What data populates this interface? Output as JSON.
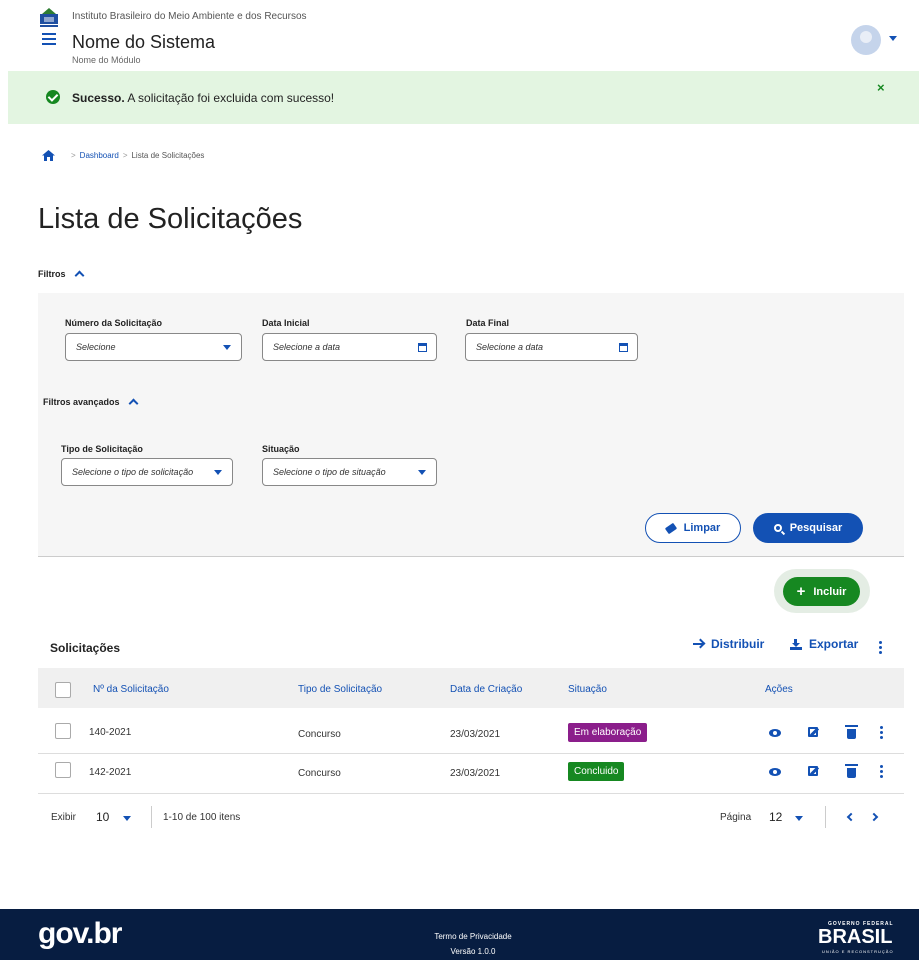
{
  "header": {
    "org": "Instituto Brasileiro do Meio Ambiente e dos Recursos",
    "system_name": "Nome do Sistema",
    "module_name": "Nome do Módulo"
  },
  "alert": {
    "strong": "Sucesso.",
    "text": " A solicitação foi excluida com sucesso!",
    "close": "×",
    "color": "#168821"
  },
  "breadcrumb": {
    "items": [
      "Dashboard",
      "Lista de Solicitações"
    ],
    "separator": ">"
  },
  "page_title": "Lista de Solicitações",
  "filters": {
    "label": "Filtros",
    "numero_label": "Número da Solicitação",
    "numero_value": "Selecione",
    "data_inicial_label": "Data Inicial",
    "data_inicial_placeholder": "Selecione a data",
    "data_final_label": "Data Final",
    "data_final_placeholder": "Selecione a data",
    "advanced_label": "Filtros avançados",
    "tipo_label": "Tipo de Solicitação",
    "tipo_value": "Selecione o tipo de solicitação",
    "situacao_label": "Situação",
    "situacao_value": "Selecione o tipo de situação",
    "clear_label": "Limpar",
    "search_label": "Pesquisar"
  },
  "add_label": "Incluir",
  "table": {
    "title": "Solicitações",
    "distribuir_label": "Distribuir",
    "exportar_label": "Exportar",
    "columns": [
      "Nº da Solicitação",
      "Tipo de Solicitação",
      "Data de Criação",
      "Situação",
      "Ações"
    ],
    "rows": [
      {
        "numero": "140-2021",
        "tipo": "Concurso",
        "data": "23/03/2021",
        "situacao": "Em elaboração",
        "status_color": "#8b1e8b"
      },
      {
        "numero": "142-2021",
        "tipo": "Concurso",
        "data": "23/03/2021",
        "situacao": "Concluido",
        "status_color": "#168821"
      }
    ]
  },
  "pagination": {
    "exibir_label": "Exibir",
    "per_page": "10",
    "range_text": "1-10 de 100 itens",
    "pagina_label": "Página",
    "page": "12"
  },
  "footer": {
    "logo": "gov.br",
    "privacy": "Termo de Privacidade",
    "version": "Versão 1.0.0",
    "gov_federal": "GOVERNO FEDERAL",
    "brasil": "BRASIL",
    "tagline": "UNIÃO E RECONSTRUÇÃO"
  },
  "colors": {
    "primary": "#1351b4",
    "success": "#168821",
    "footer_bg": "#071d41"
  }
}
